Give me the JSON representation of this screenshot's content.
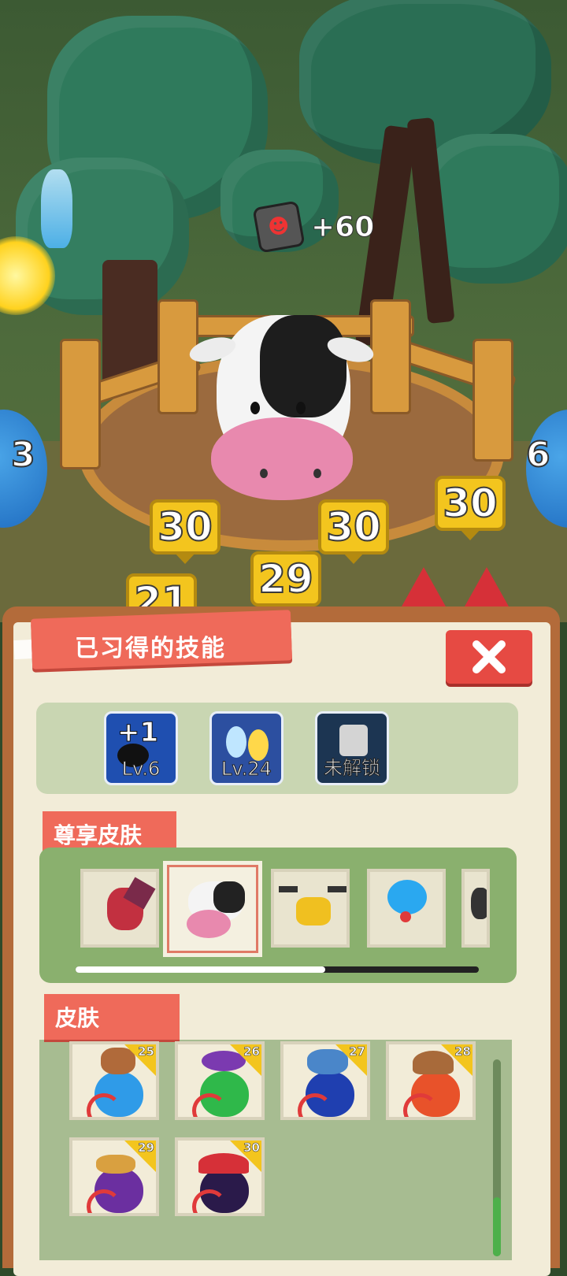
{
  "scene": {
    "reward_amount": "+60",
    "counters": [
      "30",
      "30",
      "30",
      "29",
      "21"
    ],
    "side_left_num": "3",
    "side_right_num": "6"
  },
  "panel": {
    "title": "已习得的技能",
    "close_label": "✕",
    "skills": [
      {
        "name": "+1",
        "level": "Lv.6",
        "color": "#1f4fb0"
      },
      {
        "name": "feather",
        "level": "Lv.24",
        "color": "#2c4fa0"
      },
      {
        "name": "lock",
        "level": "未解锁",
        "color": "#1c3552"
      }
    ],
    "premium_title": "尊享皮肤",
    "premium_skins": [
      "dragon",
      "cow",
      "drone",
      "jelly",
      "cat"
    ],
    "premium_scroll_fraction": 0.62,
    "skins_title": "皮肤",
    "skins": [
      {
        "level": "25",
        "color": "#2f9be8",
        "top": "#b06a3a"
      },
      {
        "level": "26",
        "color": "#2fb84a",
        "top": "#7b3ab0"
      },
      {
        "level": "27",
        "color": "#1f3fb0",
        "top": "#4a86c9"
      },
      {
        "level": "28",
        "color": "#e8522a",
        "top": "#a86a3a"
      },
      {
        "level": "29",
        "color": "#6b2fa0",
        "top": "#d9a040"
      },
      {
        "level": "30",
        "color": "#2a1a4a",
        "top": "#d63038"
      }
    ]
  }
}
